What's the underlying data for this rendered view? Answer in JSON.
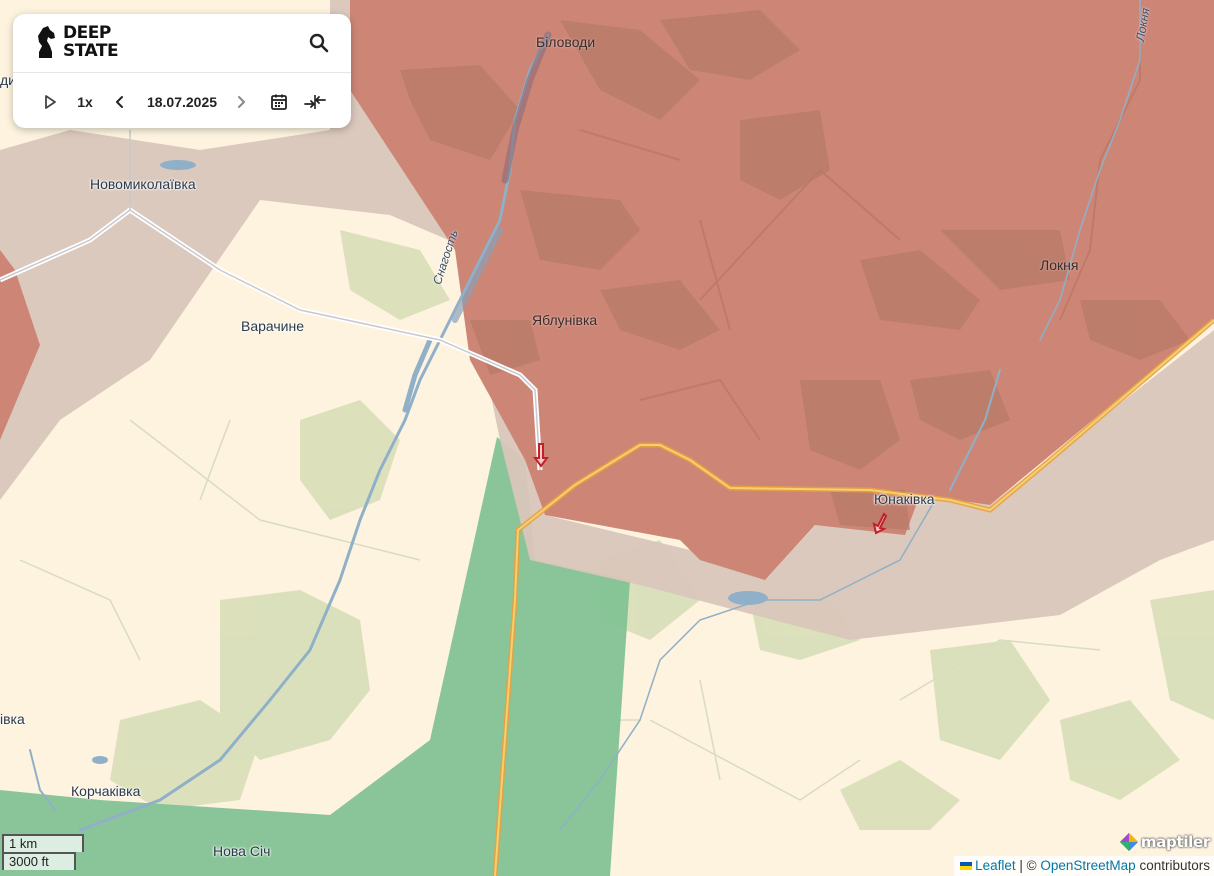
{
  "app": {
    "brand_line1": "DEEP",
    "brand_line2": "STATE"
  },
  "toolbar": {
    "speed": "1x",
    "date": "18.07.2025"
  },
  "places": {
    "bilovody": "Біловоди",
    "novomykolaivka": "Новомиколаївка",
    "varachyne": "Варачине",
    "yablunivka": "Яблунівка",
    "loknia": "Локня",
    "loknia_river": "Локня",
    "snagost_river": "Снагость",
    "yunakivka": "Юнаківка",
    "korchakivka": "Корчаківка",
    "nova_sich": "Нова Січ",
    "partial_left_bottom": "івка",
    "partial_left_top": "ди"
  },
  "scale": {
    "metric": "1 km",
    "imperial": "3000 ft"
  },
  "attribution": {
    "leaflet": "Leaflet",
    "separator": "| ©",
    "osm": "OpenStreetMap",
    "suffix": "contributors",
    "maptiler": "maptiler"
  },
  "colors": {
    "land": "#fdf3df",
    "occupied": "#cd8676",
    "contested": "#d9c6bb",
    "liberated": "#7fc193",
    "road_main": "#e8a040",
    "water": "#8fb0c8"
  }
}
